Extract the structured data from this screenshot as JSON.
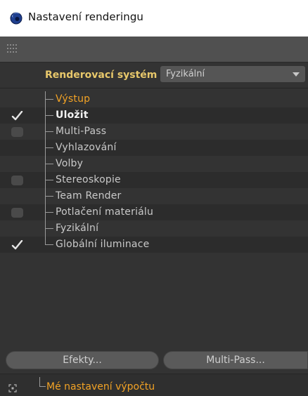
{
  "window": {
    "title": "Nastavení renderingu",
    "icon": "cinema4d-sphere-icon"
  },
  "renderer": {
    "label": "Renderovací systém",
    "value": "Fyzikální"
  },
  "tree": {
    "items": [
      {
        "label": "Výstup",
        "checkbox": "none",
        "style": "orange"
      },
      {
        "label": "Uložit",
        "checkbox": "checked",
        "style": "white"
      },
      {
        "label": "Multi-Pass",
        "checkbox": "unchecked",
        "style": "normal"
      },
      {
        "label": "Vyhlazování",
        "checkbox": "none",
        "style": "normal"
      },
      {
        "label": "Volby",
        "checkbox": "none",
        "style": "normal"
      },
      {
        "label": "Stereoskopie",
        "checkbox": "unchecked",
        "style": "normal"
      },
      {
        "label": "Team Render",
        "checkbox": "none",
        "style": "normal"
      },
      {
        "label": "Potlačení materiálu",
        "checkbox": "unchecked",
        "style": "normal"
      },
      {
        "label": "Fyzikální",
        "checkbox": "none",
        "style": "normal"
      },
      {
        "label": "Globální iluminace",
        "checkbox": "checked",
        "style": "normal"
      }
    ]
  },
  "buttons": {
    "effects_label": "Efekty...",
    "multipass_label": "Multi-Pass..."
  },
  "settings": {
    "current": "Mé nastavení výpočtu"
  },
  "colors": {
    "accent_orange": "#f3a325",
    "label_gold": "#e8c86b",
    "panel_bg": "#333333"
  }
}
